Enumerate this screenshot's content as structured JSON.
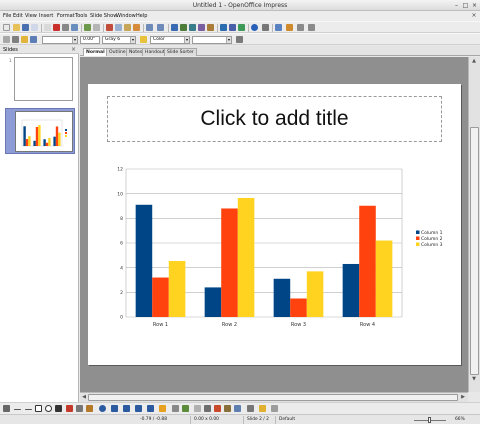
{
  "window": {
    "title": "Untitled 1 - OpenOffice Impress"
  },
  "menu": [
    "File",
    "Edit",
    "View",
    "Insert",
    "Format",
    "Tools",
    "Slide Show",
    "Window",
    "Help"
  ],
  "toolbar": {
    "font_size": "0.00\"",
    "line_color": "Gray 6",
    "area_style": "Color"
  },
  "slides_panel": {
    "title": "Slides",
    "slide_numbers": [
      "1",
      "2"
    ]
  },
  "view_tabs": [
    "Normal",
    "Outline",
    "Notes",
    "Handout",
    "Slide Sorter"
  ],
  "slide": {
    "title_placeholder": "Click to add title"
  },
  "chart_data": {
    "type": "bar",
    "categories": [
      "Row 1",
      "Row 2",
      "Row 3",
      "Row 4"
    ],
    "series": [
      {
        "name": "Column 1",
        "color": "#004586",
        "values": [
          9.1,
          2.4,
          3.1,
          4.3
        ]
      },
      {
        "name": "Column 2",
        "color": "#ff420e",
        "values": [
          3.2,
          8.8,
          1.5,
          9.02
        ]
      },
      {
        "name": "Column 3",
        "color": "#ffd320",
        "values": [
          4.54,
          9.65,
          3.7,
          6.2
        ]
      }
    ],
    "ylim": [
      0,
      12
    ],
    "yticks": [
      0,
      2,
      4,
      6,
      8,
      10,
      12
    ],
    "grid": true,
    "legend": "right"
  },
  "status": {
    "position": "-0.79 / -0.88",
    "size": "0.00 x 0.00",
    "slide": "Slide 2 / 2",
    "layout": "Default",
    "zoom": "66%"
  },
  "colors": {
    "accent": "#8d9cd6",
    "workarea": "#8f8f8f"
  }
}
